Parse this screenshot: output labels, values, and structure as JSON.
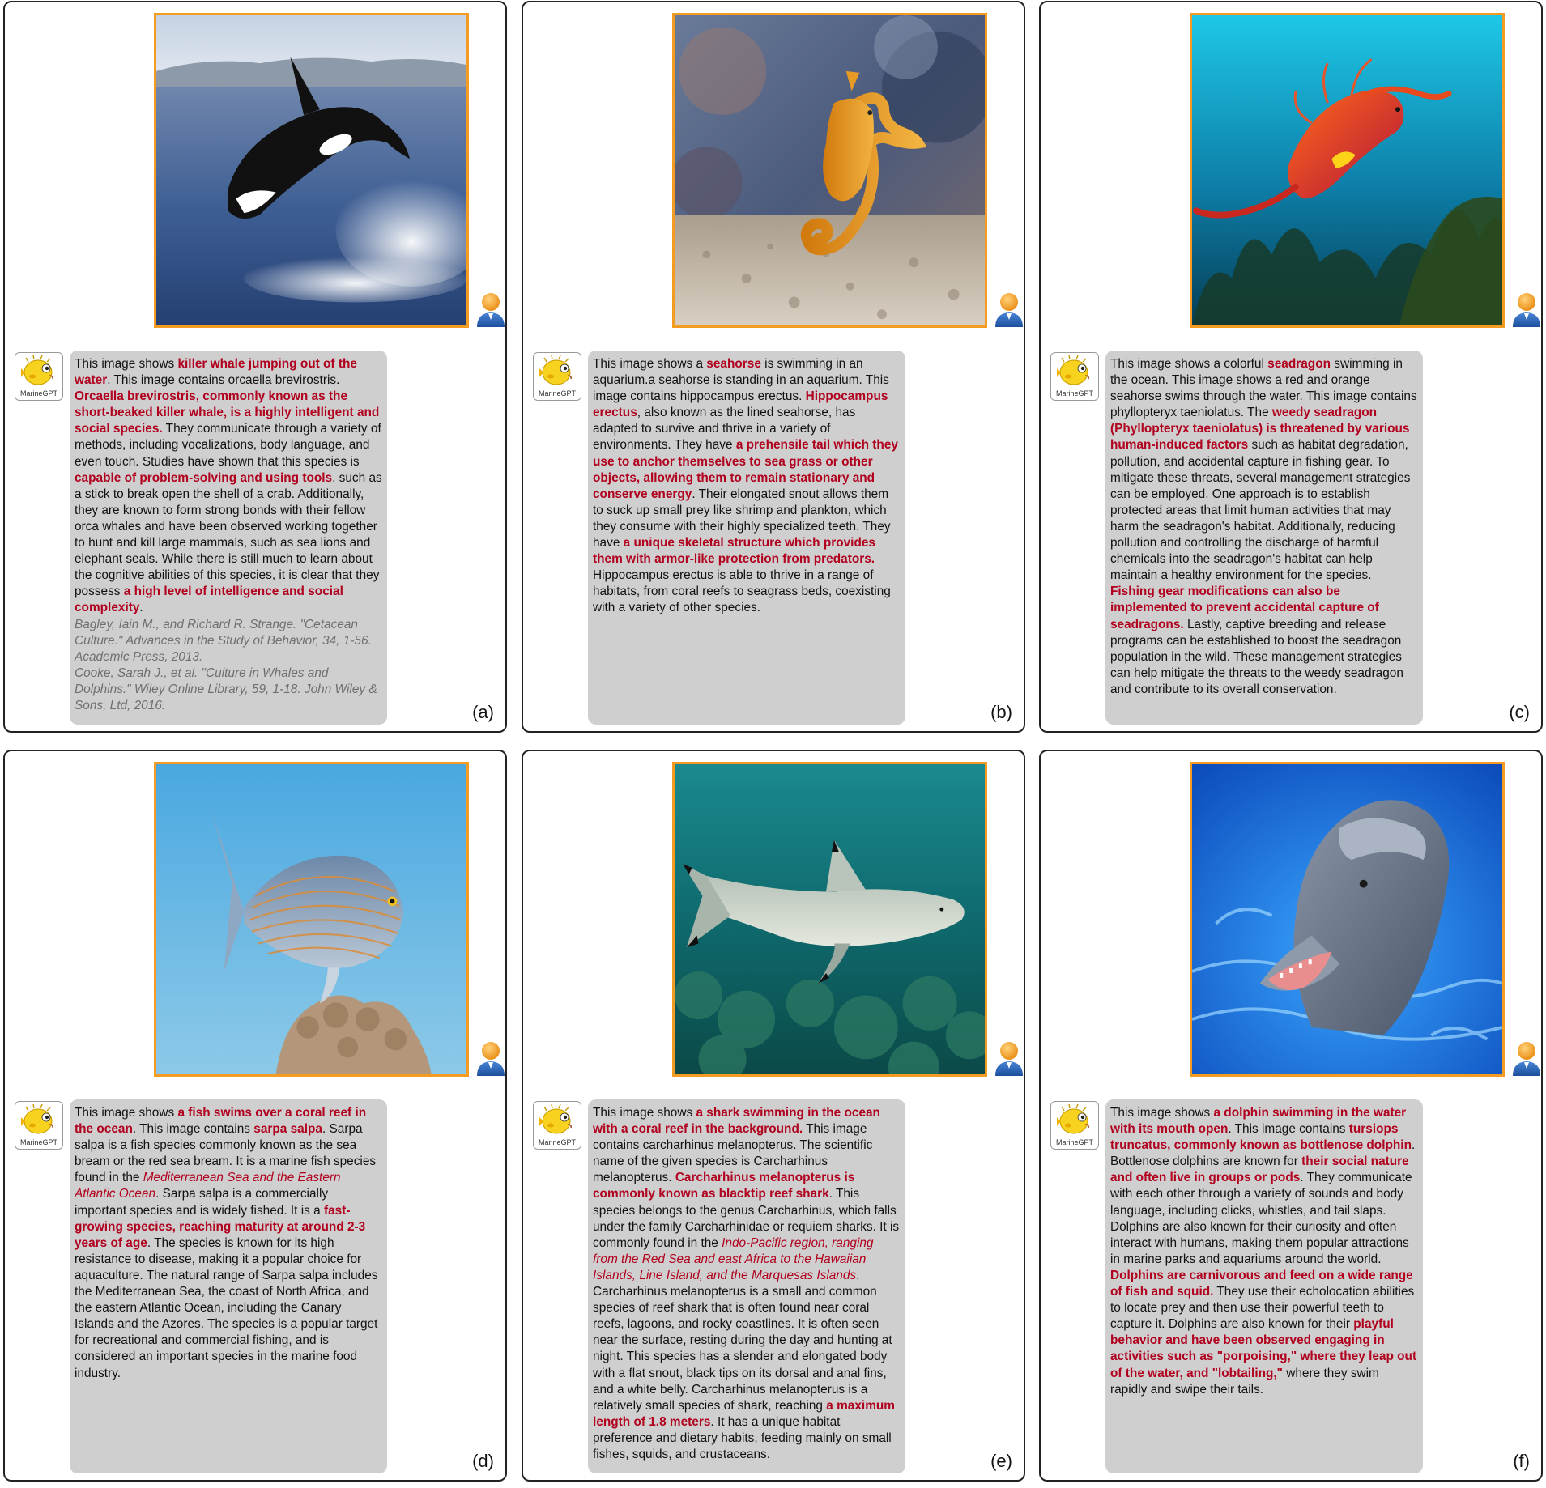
{
  "assistant_name": "MarineGPT",
  "panels": [
    {
      "label": "(a)",
      "image": "killer whale breaching from the sea",
      "segments": [
        {
          "t": "This image shows "
        },
        {
          "t": "killer whale jumping out of the water",
          "s": "hl"
        },
        {
          "t": ". This image contains orcaella brevirostris. "
        },
        {
          "t": "Orcaella brevirostris, commonly known as the short-beaked killer whale, is a highly intelligent and social species.",
          "s": "hl"
        },
        {
          "t": " They communicate through a variety of methods, including vocalizations, body language, and even touch. Studies have shown that this species is "
        },
        {
          "t": "capable of problem-solving and using tools",
          "s": "hl"
        },
        {
          "t": ", such as a stick to break open the shell of a crab. Additionally, they are known to form strong bonds with their fellow orca whales and have been observed working together to hunt and kill large mammals, such as sea lions and elephant seals. While there is still much to learn about the cognitive abilities of this species, it is clear that they possess "
        },
        {
          "t": "a high level of intelligence and social complexity",
          "s": "hl"
        },
        {
          "t": "."
        },
        {
          "t": "Bagley, Iain M., and Richard R. Strange. \"Cetacean Culture.\" Advances in the Study of Behavior, 34, 1-56. Academic Press, 2013.",
          "s": "ref"
        },
        {
          "t": "Cooke, Sarah J., et al. \"Culture in Whales and Dolphins.\" Wiley Online Library, 59, 1-18. John Wiley & Sons, Ltd, 2016.",
          "s": "ref"
        }
      ]
    },
    {
      "label": "(b)",
      "image": "seahorse standing on aquarium gravel",
      "segments": [
        {
          "t": "This image shows a "
        },
        {
          "t": "seahorse",
          "s": "hl"
        },
        {
          "t": " is swimming in an aquarium.a seahorse is standing in an aquarium. This image contains hippocampus erectus. "
        },
        {
          "t": "Hippocampus erectus",
          "s": "hl"
        },
        {
          "t": ", also known as the lined seahorse, has adapted to survive and thrive in a variety of environments. They have "
        },
        {
          "t": "a prehensile tail which they use to anchor themselves to sea grass or other objects, allowing them to remain stationary and conserve energy",
          "s": "hl"
        },
        {
          "t": ". Their elongated snout allows them to suck up small prey like shrimp and plankton, which they consume with their highly specialized teeth. They have "
        },
        {
          "t": "a unique skeletal structure which provides them with armor-like protection from predators.",
          "s": "hl"
        },
        {
          "t": " Hippocampus erectus is able to thrive in a range of habitats, from coral reefs to seagrass beds, coexisting with a variety of other species."
        }
      ]
    },
    {
      "label": "(c)",
      "image": "red and orange weedy seadragon over kelp",
      "segments": [
        {
          "t": "This image shows a colorful "
        },
        {
          "t": "seadragon",
          "s": "hl"
        },
        {
          "t": " swimming in the ocean. This image shows a red and orange seahorse swims through the water. This image contains phyllopteryx taeniolatus. The "
        },
        {
          "t": "weedy seadragon (Phyllopteryx taeniolatus) is threatened by various human-induced factors",
          "s": "hl"
        },
        {
          "t": " such as habitat degradation, pollution, and accidental capture in fishing gear. To mitigate these threats, several management strategies can be employed. One approach is to establish protected areas that limit human activities that may harm the seadragon's habitat. Additionally, reducing pollution and controlling the discharge of harmful chemicals into the seadragon's habitat can help maintain a healthy environment for the species. "
        },
        {
          "t": "Fishing gear modifications can also be implemented to prevent accidental capture of seadragons.",
          "s": "hl"
        },
        {
          "t": " Lastly, captive breeding and release programs can be established to boost the seadragon population in the wild. These management strategies can help mitigate the threats to the weedy seadragon and contribute to its overall conservation."
        }
      ]
    },
    {
      "label": "(d)",
      "image": "striped sarpa salpa fish over coral",
      "segments": [
        {
          "t": "This image shows "
        },
        {
          "t": "a fish swims over a coral reef in the ocean",
          "s": "hl"
        },
        {
          "t": ". This image contains "
        },
        {
          "t": "sarpa salpa",
          "s": "hl"
        },
        {
          "t": ". Sarpa salpa is a fish species commonly known as the sea bream or the red sea bream. It is a marine fish species found in the "
        },
        {
          "t": "Mediterranean Sea and the Eastern Atlantic Ocean",
          "s": "hi"
        },
        {
          "t": ". Sarpa salpa is a commercially important species and is widely fished. It is a "
        },
        {
          "t": "fast-growing species, reaching maturity at around 2-3 years of age",
          "s": "hl"
        },
        {
          "t": ". The species is known for its high resistance to disease, making it a popular choice for aquaculture. The natural range of Sarpa salpa includes the Mediterranean Sea, the coast of North Africa, and the eastern Atlantic Ocean, including the Canary Islands and the Azores. The species is a popular target for recreational and commercial fishing, and is considered an important species in the marine food industry."
        }
      ]
    },
    {
      "label": "(e)",
      "image": "blacktip reef shark over coral reef",
      "segments": [
        {
          "t": "This image shows "
        },
        {
          "t": "a shark swimming in the ocean with a coral reef in the background.",
          "s": "hl"
        },
        {
          "t": " This image contains carcharhinus melanopterus. The scientific name of the given species is Carcharhinus melanopterus. "
        },
        {
          "t": "Carcharhinus melanopterus is commonly known as blacktip reef shark",
          "s": "hl"
        },
        {
          "t": ". This species belongs to the genus Carcharhinus, which falls under the family Carcharhinidae or requiem sharks. It is commonly found in the "
        },
        {
          "t": "Indo-Pacific region, ranging from the Red Sea and east Africa to the Hawaiian Islands, Line Island, and the Marquesas Islands",
          "s": "hi"
        },
        {
          "t": ". Carcharhinus melanopterus is a small and common species of reef shark that is often found near coral reefs, lagoons, and rocky coastlines. It is often seen near the surface, resting during the day and hunting at night. This species has a slender and elongated body with a flat snout, black tips on its dorsal and anal fins, and a white belly. Carcharhinus melanopterus is a relatively small species of shark, reaching "
        },
        {
          "t": "a maximum length of 1.8 meters",
          "s": "hl"
        },
        {
          "t": ". It has a unique habitat preference and dietary habits, feeding mainly on small fishes, squids, and crustaceans."
        }
      ]
    },
    {
      "label": "(f)",
      "image": "dolphin with open mouth in blue water",
      "segments": [
        {
          "t": "This image shows "
        },
        {
          "t": "a dolphin swimming in the water with its mouth open",
          "s": "hl"
        },
        {
          "t": ". This image contains "
        },
        {
          "t": "tursiops truncatus, commonly known as bottlenose dolphin",
          "s": "hl"
        },
        {
          "t": ". Bottlenose dolphins are known for "
        },
        {
          "t": "their social nature and often live in groups or pods",
          "s": "hl"
        },
        {
          "t": ". They communicate with each other through a variety of sounds and body language, including clicks, whistles, and tail slaps. Dolphins are also known for their curiosity and often interact with humans, making them popular attractions in marine parks and aquariums around the world. "
        },
        {
          "t": "Dolphins are carnivorous and feed on a wide range of fish and squid.",
          "s": "hl"
        },
        {
          "t": " They use their echolocation abilities to locate prey and then use their powerful teeth to capture it. Dolphins are also known for their "
        },
        {
          "t": "playful behavior and have been observed engaging in activities such as \"porpoising,\" where they leap out of the water, and \"lobtailing,\"",
          "s": "hl"
        },
        {
          "t": " where they swim rapidly and swipe their tails."
        }
      ]
    }
  ]
}
